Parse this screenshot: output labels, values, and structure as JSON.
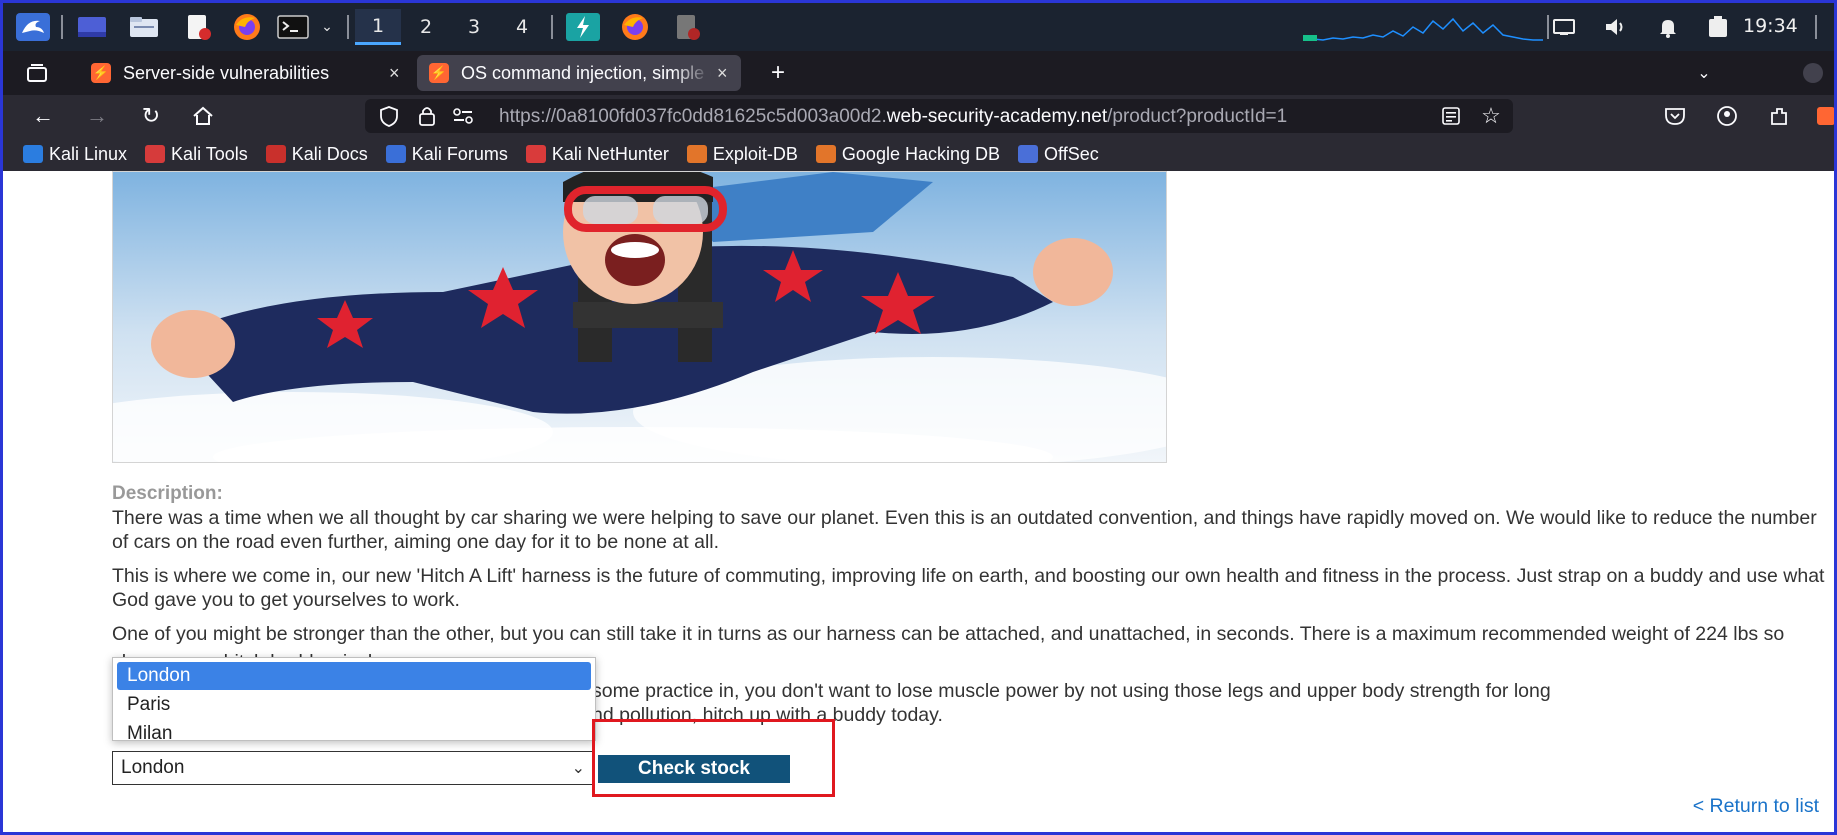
{
  "panel": {
    "workspaces": [
      "1",
      "2",
      "3",
      "4"
    ],
    "clock": "19:34",
    "icons": [
      "kali-dragon-icon",
      "show-desktop-icon",
      "file-manager-icon",
      "text-editor-icon",
      "firefox-icon",
      "terminal-icon",
      "burp-suite-icon",
      "volume-icon",
      "notification-bell-icon",
      "battery-icon"
    ]
  },
  "tabs": [
    {
      "title": "Server-side vulnerabilities",
      "close": "×"
    },
    {
      "title": "OS command injection, simple case",
      "close": "×"
    }
  ],
  "new_tab": "+",
  "url": {
    "prefix": "https://0a8100fd037fc0dd81625c5d003a00d2.",
    "domain": "web-security-academy.net",
    "path": "/product?productId=1"
  },
  "bookmarks": [
    {
      "label": "Kali Linux",
      "color": "#2b7de0"
    },
    {
      "label": "Kali Tools",
      "color": "#d63b3b"
    },
    {
      "label": "Kali Docs",
      "color": "#c9302c"
    },
    {
      "label": "Kali Forums",
      "color": "#3a6fd8"
    },
    {
      "label": "Kali NetHunter",
      "color": "#d93b3b"
    },
    {
      "label": "Exploit-DB",
      "color": "#e2752a"
    },
    {
      "label": "Google Hacking DB",
      "color": "#e2752a"
    },
    {
      "label": "OffSec",
      "color": "#4a6fd8"
    }
  ],
  "page": {
    "description_label": "Description:",
    "paragraphs": [
      "There was a time when we all thought by car sharing we were helping to save our planet. Even this is an outdated convention, and things have rapidly moved on. We would like to reduce the number of cars on the road even further, aiming one day for it to be none at all.",
      "This is where we come in, our new 'Hitch A Lift' harness is the future of commuting, improving life on earth, and boosting our own health and fitness in the process. Just strap on a buddy and use what God gave you to get yourselves to work.",
      "One of you might be stronger than the other, but you can still take it in turns as our harness can be attached, and unattached, in seconds. There is a maximum recommended weight of 224 lbs so choose your hitch buddy wisely."
    ],
    "p4_line1": "some practice in, you don't want to lose muscle power by not using those legs and upper body strength for long",
    "p4_line2": "nd pollution, hitch up with a buddy today.",
    "store_options": [
      "London",
      "Paris",
      "Milan"
    ],
    "store_selected": "London",
    "check_stock": "Check stock",
    "return_link": "< Return to list"
  },
  "accent": "#11527a",
  "highlight_color": "#e0181f"
}
